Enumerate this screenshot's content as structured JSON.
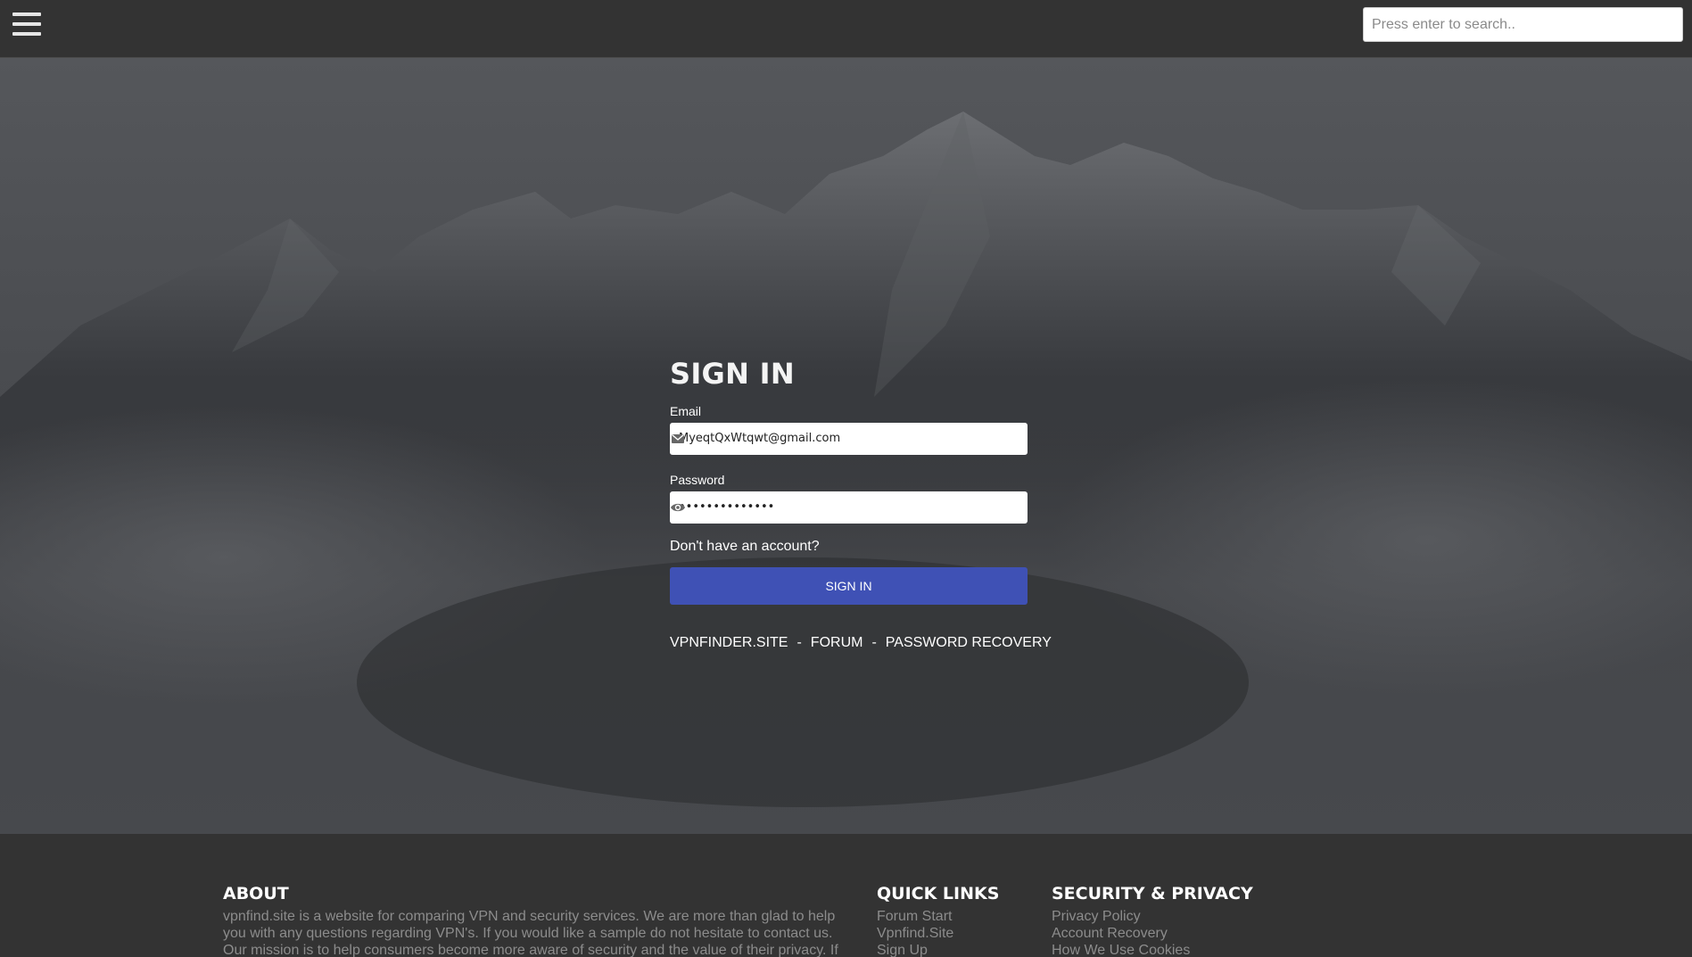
{
  "header": {
    "menu_icon": "hamburger-menu-icon",
    "search_placeholder": "Press enter to search.."
  },
  "signin": {
    "title": "SIGN IN",
    "email_label": "Email",
    "email_value": "MyeqtQxWtqwt@gmail.com",
    "email_icon": "envelope-icon",
    "password_label": "Password",
    "password_value": "••••••••••••••",
    "password_icon": "eye-icon",
    "no_account_text": "Don't have an account?",
    "button_label": "SIGN IN",
    "button_color": "#3f51b5",
    "links": [
      "VPNFINDER.SITE",
      "FORUM",
      "PASSWORD RECOVERY"
    ],
    "separator": "-"
  },
  "footer": {
    "about": {
      "title": "ABOUT",
      "text": "vpnfind.site is a website for comparing VPN and security services. We are more than glad to help you with any questions regarding VPN's. If you would like a sample do not hesitate to contact us. Our mission is to help consumers become more aware of security and the value of their privacy. If"
    },
    "quick_links": {
      "title": "QUICK LINKS",
      "items": [
        "Forum Start",
        "Vpnfind.Site",
        "Sign Up"
      ]
    },
    "security": {
      "title": "SECURITY & PRIVACY",
      "items": [
        "Privacy Policy",
        "Account Recovery",
        "How We Use Cookies"
      ]
    }
  }
}
